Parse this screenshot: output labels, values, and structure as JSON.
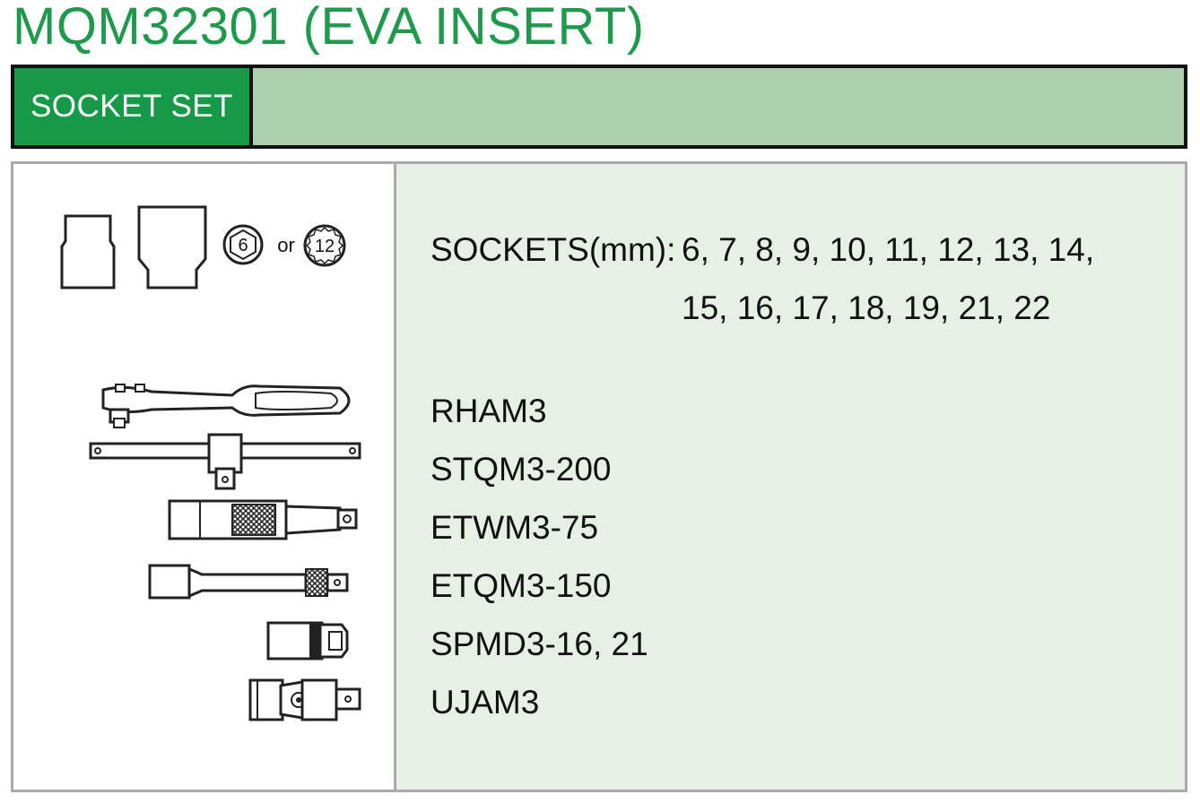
{
  "title": "MQM32301  (EVA INSERT)",
  "header": {
    "label": "SOCKET SET"
  },
  "sockets": {
    "label": "SOCKETS(mm):",
    "line1": "6, 7, 8, 9, 10, 11, 12, 13, 14,",
    "line2": "15, 16, 17, 18, 19, 21, 22",
    "hex_options": {
      "six": "6",
      "or": "or",
      "twelve": "12"
    }
  },
  "items": [
    {
      "code": "RHAM3",
      "icon": "ratchet-handle-icon"
    },
    {
      "code": "STQM3-200",
      "icon": "sliding-t-bar-icon"
    },
    {
      "code": "ETWM3-75",
      "icon": "wobble-extension-icon"
    },
    {
      "code": "ETQM3-150",
      "icon": "extension-bar-icon"
    },
    {
      "code": "SPMD3-16, 21",
      "icon": "spark-plug-socket-icon"
    },
    {
      "code": "UJAM3",
      "icon": "universal-joint-icon"
    }
  ],
  "colors": {
    "title_green": "#1e9a4b",
    "header_green": "#169a48",
    "header_bar": "#abcead",
    "panel_bg": "#e6f0e4",
    "border_gray": "#aaaaaa"
  }
}
